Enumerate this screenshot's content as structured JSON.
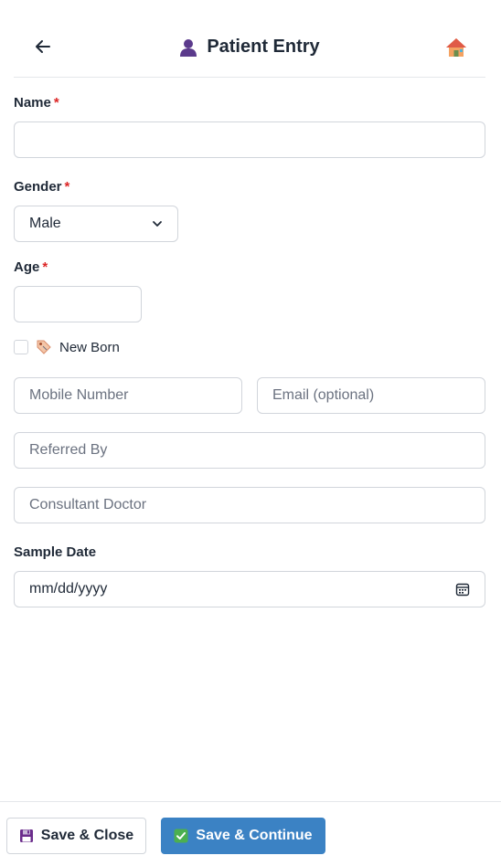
{
  "header": {
    "title": "Patient Entry",
    "back_icon": "arrow-left-icon",
    "title_icon": "user-silhouette-icon",
    "home_icon": "house-icon"
  },
  "form": {
    "name": {
      "label": "Name",
      "required_mark": "*",
      "value": ""
    },
    "gender": {
      "label": "Gender",
      "required_mark": "*",
      "selected": "Male"
    },
    "age": {
      "label": "Age",
      "required_mark": "*",
      "value": ""
    },
    "new_born": {
      "label": "New Born",
      "checked": false,
      "icon": "tag-icon"
    },
    "mobile": {
      "placeholder": "Mobile Number",
      "value": ""
    },
    "email": {
      "placeholder": "Email (optional)",
      "value": ""
    },
    "referred_by": {
      "placeholder": "Referred By",
      "value": ""
    },
    "consultant": {
      "placeholder": "Consultant Doctor",
      "value": ""
    },
    "sample_date": {
      "label": "Sample Date",
      "value": "mm/dd/yyyy"
    }
  },
  "footer": {
    "save_close_label": "Save & Close",
    "save_continue_label": "Save & Continue",
    "save_close_icon": "floppy-disk-icon",
    "save_continue_icon": "check-box-icon"
  },
  "colors": {
    "primary": "#3b82c4",
    "required": "#dc2626",
    "text": "#1f2937",
    "border": "#d1d5db"
  }
}
